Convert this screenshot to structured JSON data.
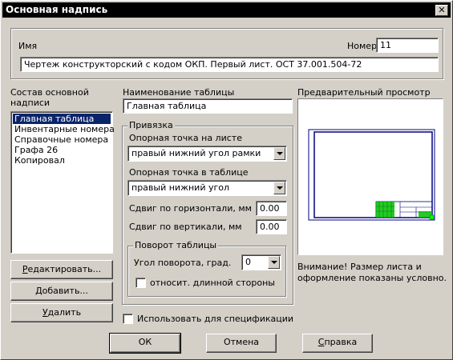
{
  "window": {
    "title": "Основная надпись",
    "close_glyph": "✕"
  },
  "header_group": {
    "name_label": "Имя",
    "number_label": "Номер",
    "number_value": "11",
    "name_value": "Чертеж конструкторский с кодом ОКП. Первый лист. ОСТ 37.001.504-72"
  },
  "composition": {
    "label_line1": "Состав основной",
    "label_line2": "надписи",
    "items": [
      "Главная таблица",
      "Инвентарные номера",
      "Справочные номера",
      "Графа 26",
      "Копировал"
    ],
    "selected_index": 0
  },
  "side_buttons": {
    "edit_label_u": "Р",
    "edit_label_rest": "едактировать...",
    "add_label_u": "Д",
    "add_label_rest": "обавить...",
    "delete_label_u": "У",
    "delete_label_rest": "далить"
  },
  "table_name": {
    "label": "Наименование таблицы",
    "value": "Главная таблица"
  },
  "binding": {
    "group_label": "Привязка",
    "sheet_point_label": "Опорная точка на листе",
    "sheet_point_value": "правый нижний угол рамки",
    "table_point_label": "Опорная точка в таблице",
    "table_point_value": "правый нижний угол",
    "hshift_label": "Сдвиг по горизонтали, мм",
    "hshift_value": "0.00",
    "vshift_label": "Сдвиг по вертикали, мм",
    "vshift_value": "0.00"
  },
  "rotation": {
    "group_label": "Поворот таблицы",
    "angle_label": "Угол поворота, град.",
    "angle_value": "0",
    "relative_label": "относит. длинной стороны"
  },
  "spec_checkbox_label": "Использовать для спецификации",
  "preview": {
    "label": "Предварительный просмотр",
    "note_line1": "Внимание! Размер листа и",
    "note_line2": "оформление показаны условно.",
    "frame_color": "#000080",
    "table_color": "#00c000"
  },
  "footer": {
    "ok_label": "ОК",
    "cancel_label": "Отмена",
    "help_label_u": "С",
    "help_label_rest": "правка"
  }
}
